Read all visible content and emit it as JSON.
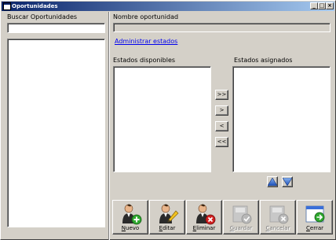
{
  "window": {
    "title": "Oportunidades"
  },
  "titlebar": {
    "minimize": "_",
    "maximize": "□",
    "close": "×"
  },
  "left": {
    "search_label": "Buscar Oportunidades",
    "search_value": "",
    "list_items": []
  },
  "right": {
    "name_label": "Nombre oportunidad",
    "name_value": "",
    "manage_link": "Administrar estados",
    "available_label": "Estados disponibles",
    "assigned_label": "Estados asignados",
    "move_buttons": {
      "add_all": ">>",
      "add_one": ">",
      "remove_one": "<",
      "remove_all": "<<"
    }
  },
  "toolbar": {
    "nuevo": "Nuevo",
    "editar": "Editar",
    "eliminar": "Eliminar",
    "guardar": "Guardar",
    "cancelar": "Cancelar",
    "cerrar": "Cerrar"
  },
  "icons": {
    "up": "arrow-up-icon",
    "down": "arrow-down-icon",
    "nuevo": "user-add-icon",
    "editar": "user-edit-icon",
    "eliminar": "user-delete-icon",
    "guardar": "save-check-icon",
    "cancelar": "cancel-x-icon",
    "cerrar": "window-exit-icon"
  },
  "colors": {
    "titlebar_start": "#0a246a",
    "titlebar_end": "#a6caf0",
    "face": "#d4d0c8",
    "link": "#0000ee"
  }
}
